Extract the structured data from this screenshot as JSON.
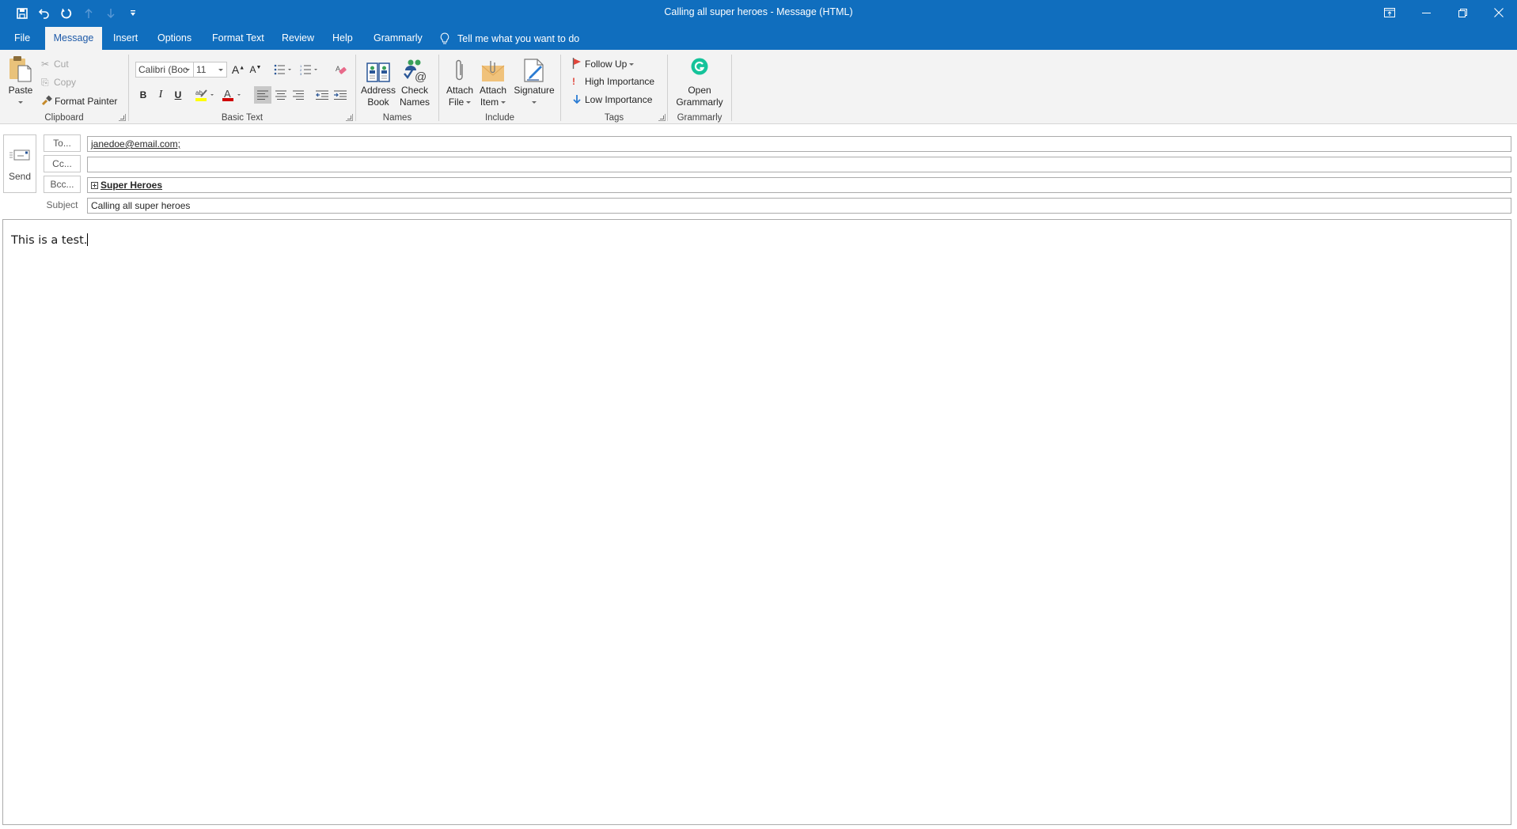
{
  "window": {
    "title": "Calling all super heroes  -  Message (HTML)",
    "quick_access": [
      {
        "icon": "save-icon",
        "enabled": true
      },
      {
        "icon": "undo-icon",
        "enabled": true
      },
      {
        "icon": "redo-icon",
        "enabled": true
      },
      {
        "icon": "previous-item-icon",
        "enabled": false
      },
      {
        "icon": "next-item-icon",
        "enabled": false
      },
      {
        "icon": "customize-qat-icon",
        "enabled": true
      }
    ],
    "controls": [
      "ribbon-display-options-icon",
      "minimize-icon",
      "restore-icon",
      "close-icon"
    ]
  },
  "tabs": [
    {
      "label": "File",
      "active": false
    },
    {
      "label": "Message",
      "active": true
    },
    {
      "label": "Insert",
      "active": false
    },
    {
      "label": "Options",
      "active": false
    },
    {
      "label": "Format Text",
      "active": false
    },
    {
      "label": "Review",
      "active": false
    },
    {
      "label": "Help",
      "active": false
    },
    {
      "label": "Grammarly",
      "active": false
    }
  ],
  "tell_me": {
    "placeholder": "Tell me what you want to do",
    "icon": "lightbulb-icon"
  },
  "ribbon": {
    "clipboard": {
      "label": "Clipboard",
      "paste": "Paste",
      "cut": "Cut",
      "copy": "Copy",
      "format_painter": "Format Painter"
    },
    "basic_text": {
      "label": "Basic Text",
      "font_name": "Calibri (Boc",
      "font_size": "11",
      "bold": "B",
      "italic": "I",
      "underline": "U",
      "highlight_color": "#ffff00",
      "font_color": "#d00000",
      "active_alignment": "left"
    },
    "names": {
      "label": "Names",
      "address_book": [
        "Address",
        "Book"
      ],
      "check_names": [
        "Check",
        "Names"
      ]
    },
    "include": {
      "label": "Include",
      "attach_file": [
        "Attach",
        "File"
      ],
      "attach_item": [
        "Attach",
        "Item"
      ],
      "signature": "Signature"
    },
    "tags": {
      "label": "Tags",
      "follow_up": "Follow Up",
      "high_importance": "High Importance",
      "low_importance": "Low Importance"
    },
    "grammarly": {
      "label": "Grammarly",
      "open": [
        "Open",
        "Grammarly"
      ],
      "brand_color": "#15c39a"
    }
  },
  "compose": {
    "send_label": "Send",
    "to_label": "To...",
    "cc_label": "Cc...",
    "bcc_label": "Bcc...",
    "subject_label": "Subject",
    "to_value": "janedoe@email.com;",
    "cc_value": "",
    "bcc_value": "Super Heroes",
    "subject_value": "Calling all super heroes",
    "body_text": "This is a test."
  },
  "colors": {
    "titlebar": "#106ebe",
    "ribbon_bg": "#f3f3f3",
    "active_tab_text": "#1e5aa8"
  }
}
